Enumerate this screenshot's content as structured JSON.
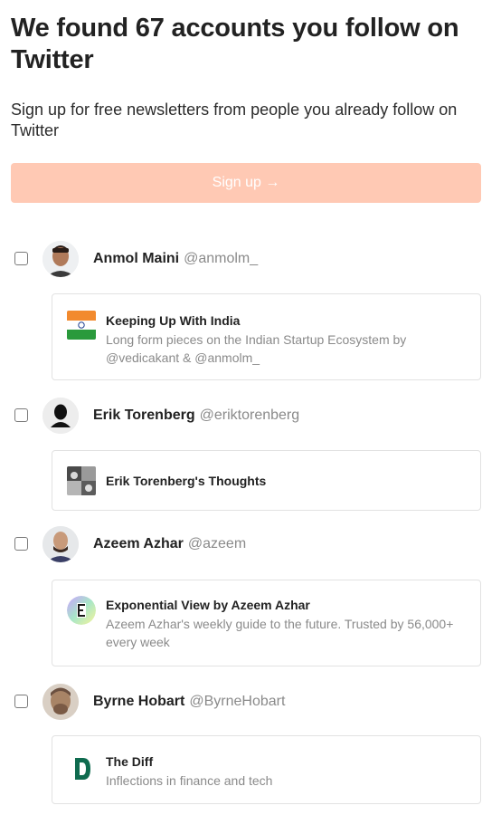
{
  "header": {
    "title": "We found 67 accounts you follow on Twitter",
    "subtitle": "Sign up for free newsletters from people you already follow on Twitter",
    "signup_label": "Sign up →"
  },
  "accounts": [
    {
      "name": "Anmol Maini",
      "handle": "@anmolm_",
      "publication": {
        "title": "Keeping Up With India",
        "description": "Long form pieces on the Indian Startup Ecosystem by @vedicakant & @anmolm_",
        "logo": "india-flag-icon"
      }
    },
    {
      "name": "Erik Torenberg",
      "handle": "@eriktorenberg",
      "publication": {
        "title": "Erik Torenberg's Thoughts",
        "description": "",
        "logo": "photo-collage-icon"
      }
    },
    {
      "name": "Azeem Azhar",
      "handle": "@azeem",
      "publication": {
        "title": "Exponential View by Azeem Azhar",
        "description": "Azeem Azhar's weekly guide to the future. Trusted by 56,000+ every week",
        "logo": "exponential-view-logo-icon"
      }
    },
    {
      "name": "Byrne Hobart",
      "handle": "@ByrneHobart",
      "publication": {
        "title": "The Diff",
        "description": "Inflections in finance and tech",
        "logo": "the-diff-logo-icon"
      }
    }
  ],
  "colors": {
    "signup_button_bg": "#ffc9b4",
    "handle_text": "#8a8a8a",
    "card_border": "#e2e2e2"
  }
}
